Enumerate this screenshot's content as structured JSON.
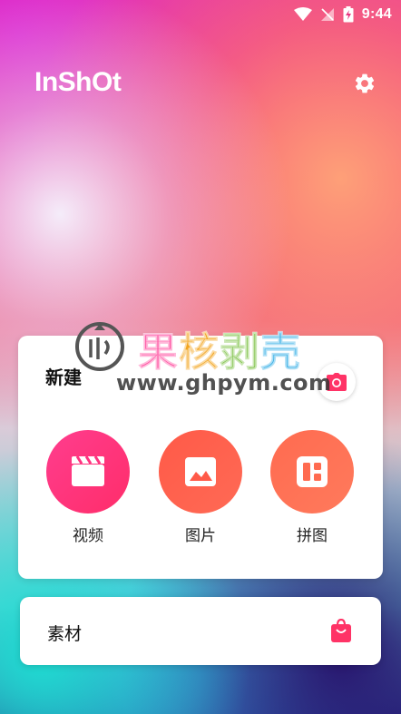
{
  "status_bar": {
    "time": "9:44",
    "icons": [
      "wifi-icon",
      "no-signal-icon",
      "battery-charging-icon"
    ]
  },
  "header": {
    "logo": "InShOt",
    "settings_icon": "gear-icon"
  },
  "create_card": {
    "title": "新建",
    "camera_icon": "camera-icon",
    "tools": [
      {
        "label": "视频",
        "icon": "clapperboard-icon",
        "color": "#ff3380"
      },
      {
        "label": "图片",
        "icon": "image-icon",
        "color": "#ff5a48"
      },
      {
        "label": "拼图",
        "icon": "collage-icon",
        "color": "#ff6b50"
      }
    ]
  },
  "material_card": {
    "label": "素材",
    "icon": "shopping-bag-icon",
    "color": "#ff3366"
  },
  "watermark": {
    "cn_chars": [
      "果",
      "核",
      "剥",
      "壳"
    ],
    "cn_colors": [
      "#ff4fa0",
      "#f2a31b",
      "#7bc043",
      "#39b0e6"
    ],
    "url": "www.ghpym.com"
  },
  "colors": {
    "accent": "#ff3366"
  }
}
